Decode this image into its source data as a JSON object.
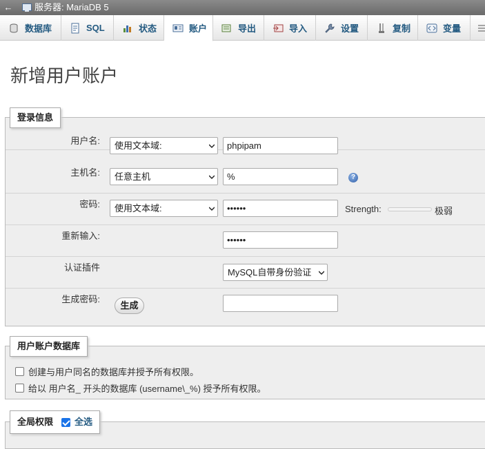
{
  "topbar": {
    "back_glyph": "←",
    "server_icon": "server-icon",
    "title": "服务器: MariaDB 5"
  },
  "tabs": [
    {
      "label": "数据库",
      "icon": "database-icon"
    },
    {
      "label": "SQL",
      "icon": "sql-icon"
    },
    {
      "label": "状态",
      "icon": "status-icon"
    },
    {
      "label": "账户",
      "icon": "users-icon",
      "active": true
    },
    {
      "label": "导出",
      "icon": "export-icon"
    },
    {
      "label": "导入",
      "icon": "import-icon"
    },
    {
      "label": "设置",
      "icon": "wrench-icon"
    },
    {
      "label": "复制",
      "icon": "replication-icon"
    },
    {
      "label": "变量",
      "icon": "variables-icon"
    }
  ],
  "page_title": "新增用户账户",
  "login": {
    "legend": "登录信息",
    "username": {
      "label": "用户名:",
      "select": "使用文本域:",
      "value": "phpipam"
    },
    "hostname": {
      "label": "主机名:",
      "select": "任意主机",
      "value": "%"
    },
    "password": {
      "label": "密码:",
      "select": "使用文本域:",
      "value": "••••••",
      "strength_label": "Strength:",
      "strength_text": "极弱",
      "strength_level": 0
    },
    "retype": {
      "label": "重新输入:",
      "value": "••••••"
    },
    "auth_plugin": {
      "label": "认证插件",
      "select": "MySQL自带身份验证"
    },
    "generate": {
      "label": "生成密码:",
      "button": "生成",
      "value": ""
    }
  },
  "database": {
    "legend": "用户账户数据库",
    "options": [
      {
        "label": "创建与用户同名的数据库并授予所有权限。",
        "checked": false
      },
      {
        "label": "给以 用户名_ 开头的数据库 (username\\_%) 授予所有权限。",
        "checked": false
      }
    ]
  },
  "global": {
    "legend": "全局权限",
    "select_all_label": "全选",
    "select_all_checked": true
  }
}
